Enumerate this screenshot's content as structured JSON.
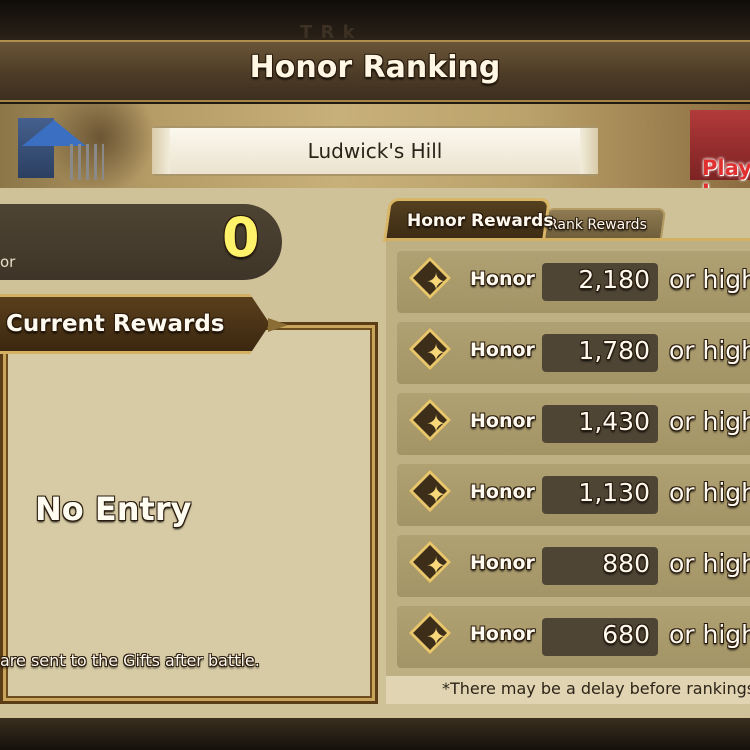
{
  "header": {
    "ghost_title": "T   R   k",
    "title": "Honor Ranking"
  },
  "banner": {
    "stage_name": "Ludwick's Hill",
    "play_label": "Play I"
  },
  "score": {
    "label": "or",
    "value": "0"
  },
  "current_rewards": {
    "title": "Current Rewards",
    "empty_text": "No Entry",
    "note": "are sent to the Gifts after battle."
  },
  "tabs": [
    {
      "label": "Honor Rewards",
      "active": true
    },
    {
      "label": "Rank Rewards",
      "active": false
    }
  ],
  "rewards": [
    {
      "label": "Honor",
      "value": "2,180",
      "suffix": "or high"
    },
    {
      "label": "Honor",
      "value": "1,780",
      "suffix": "or high"
    },
    {
      "label": "Honor",
      "value": "1,430",
      "suffix": "or high"
    },
    {
      "label": "Honor",
      "value": "1,130",
      "suffix": "or high"
    },
    {
      "label": "Honor",
      "value": "880",
      "suffix": "or high"
    },
    {
      "label": "Honor",
      "value": "680",
      "suffix": "or high"
    }
  ],
  "footer_note": "*There may be a delay before rankings",
  "icons": {
    "reward": "honor-diamond-icon",
    "star": "✦"
  },
  "colors": {
    "score": "#fff26b",
    "accent_gold": "#d9b566",
    "panel": "#cfc298",
    "play_red": "#e03030"
  }
}
